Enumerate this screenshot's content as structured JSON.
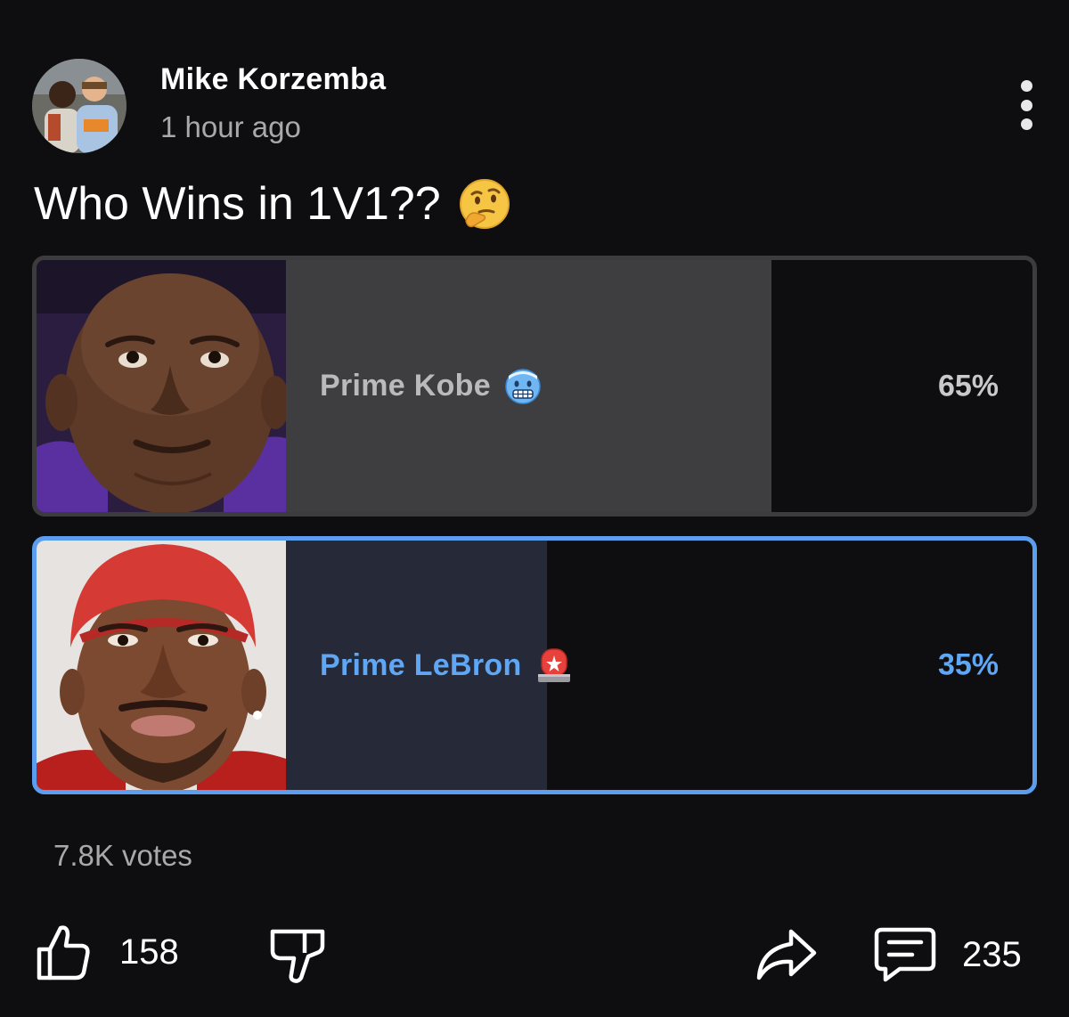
{
  "author": {
    "name": "Mike Korzemba",
    "timestamp": "1 hour ago"
  },
  "post": {
    "title": "Who Wins in 1V1??",
    "title_emoji": "thinking-face-emoji"
  },
  "poll": {
    "options": [
      {
        "label": "Prime Kobe",
        "emoji": "cold-face-emoji",
        "percent_text": "65%",
        "share": 0.65,
        "selected": false
      },
      {
        "label": "Prime LeBron",
        "emoji": "police-light-emoji",
        "percent_text": "35%",
        "share": 0.35,
        "selected": true
      }
    ],
    "votes": "7.8K votes"
  },
  "actions": {
    "like_count": "158",
    "comment_count": "235"
  },
  "colors": {
    "background": "#0e0e10",
    "selected_accent": "#5fa6f4",
    "unselected_fill": "#3e3e40",
    "selected_fill": "#262938",
    "muted_text": "#a8a8ad"
  }
}
